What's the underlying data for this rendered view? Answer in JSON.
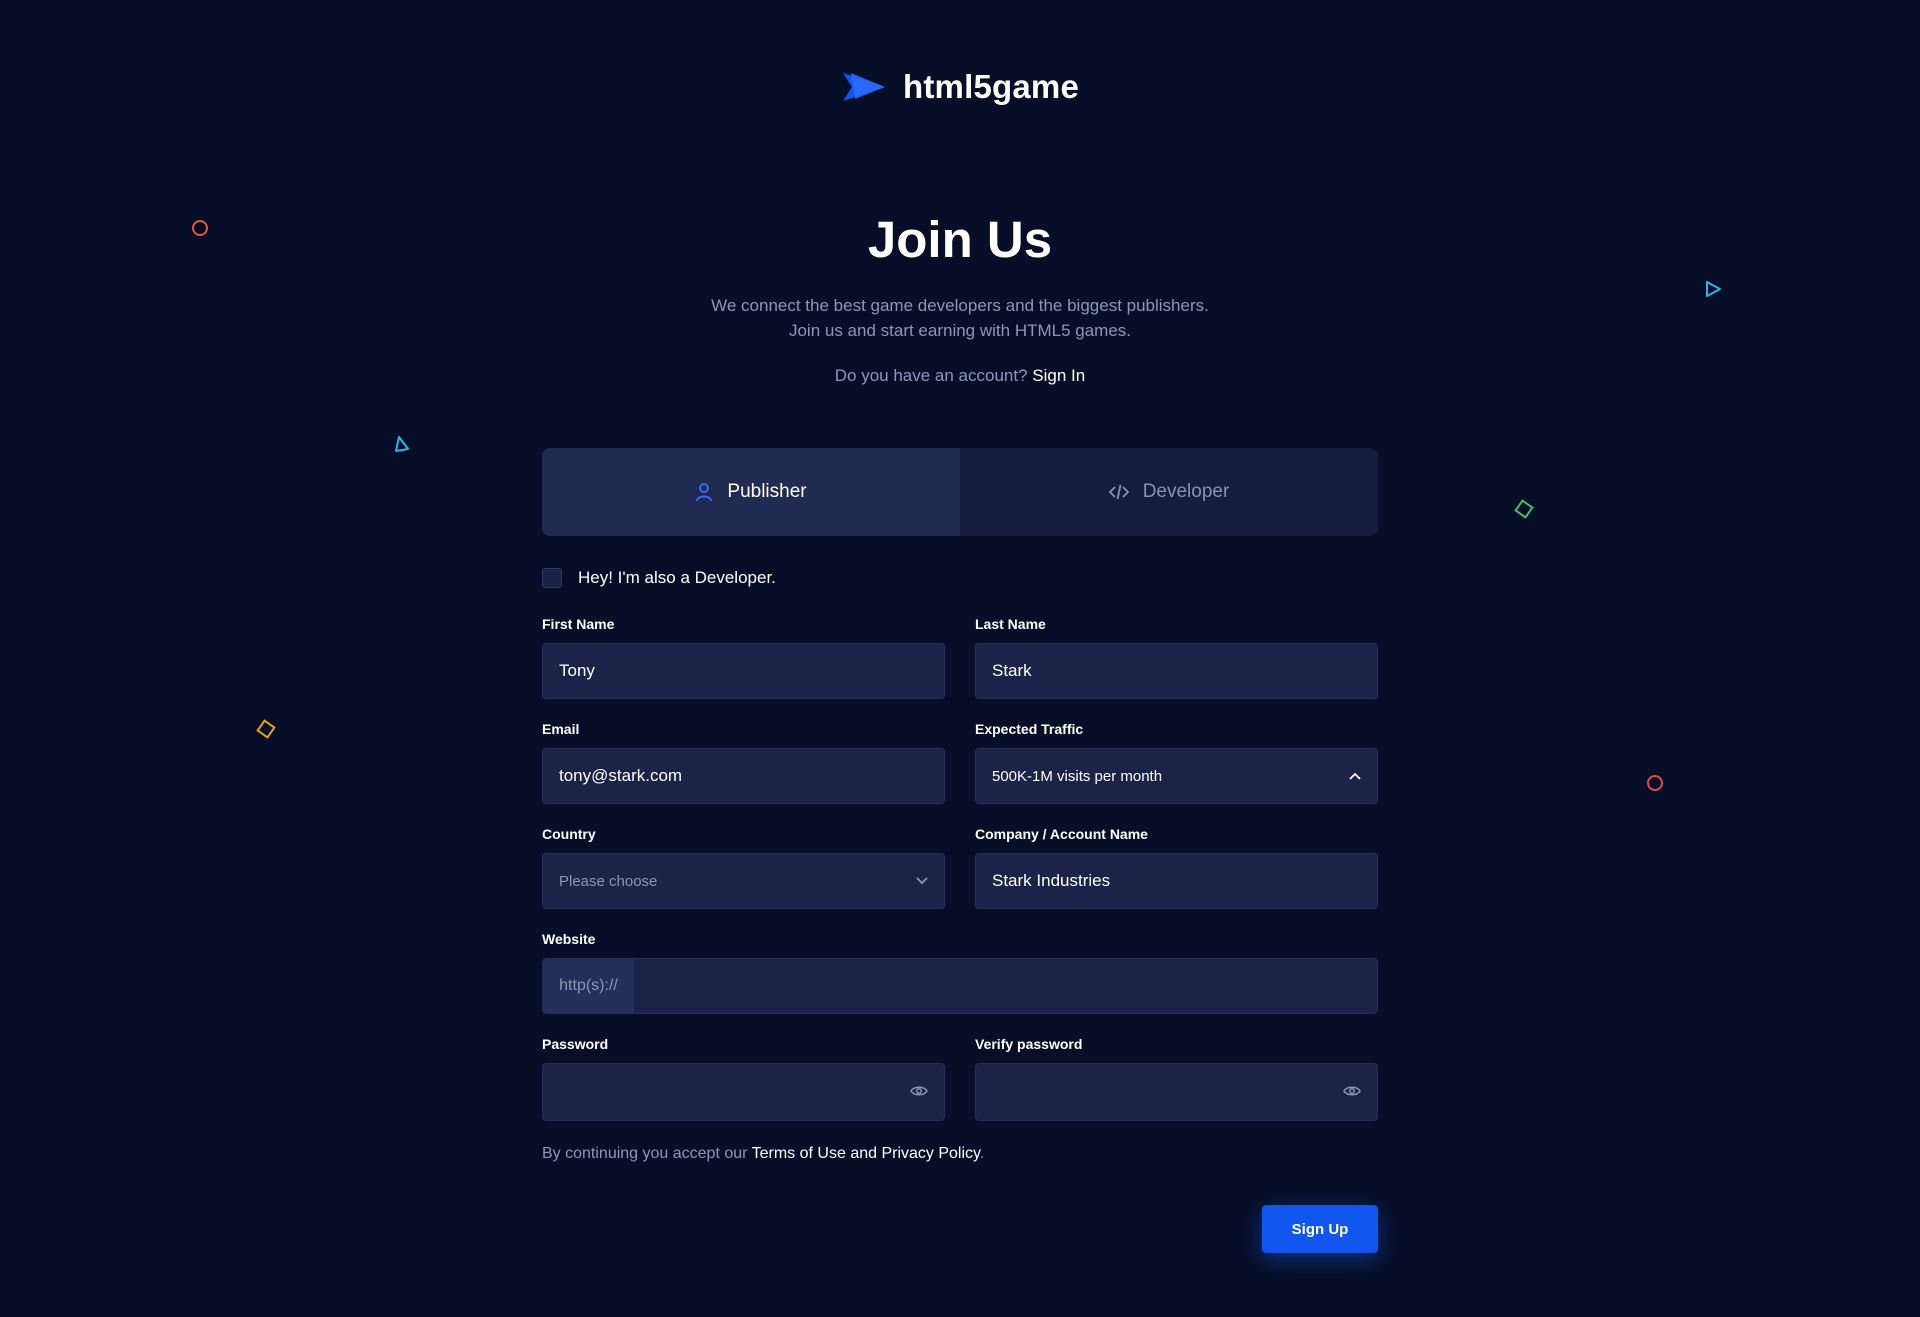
{
  "brand": {
    "name": "html5game"
  },
  "hero": {
    "title": "Join Us",
    "subtitle_line1": "We connect the best game developers and the biggest publishers.",
    "subtitle_line2": "Join us and start earning with HTML5 games.",
    "account_prompt": "Do you have an account?",
    "sign_in_label": "Sign In"
  },
  "tabs": [
    {
      "label": "Publisher",
      "icon": "user-icon",
      "active": true
    },
    {
      "label": "Developer",
      "icon": "code-icon",
      "active": false
    }
  ],
  "also_developer_label": "Hey! I'm also a Developer.",
  "fields": {
    "first_name": {
      "label": "First Name",
      "value": "Tony"
    },
    "last_name": {
      "label": "Last Name",
      "value": "Stark"
    },
    "email": {
      "label": "Email",
      "value": "tony@stark.com"
    },
    "expected_traffic": {
      "label": "Expected Traffic",
      "value": "500K-1M visits per month"
    },
    "country": {
      "label": "Country",
      "placeholder": "Please choose"
    },
    "company": {
      "label": "Company / Account Name",
      "value": "Stark Industries"
    },
    "website": {
      "label": "Website",
      "prefix": "http(s)://",
      "value": ""
    },
    "password": {
      "label": "Password",
      "value": ""
    },
    "verify_password": {
      "label": "Verify password",
      "value": ""
    }
  },
  "terms": {
    "prefix": "By continuing you accept our",
    "link": "Terms of Use and Privacy Policy",
    "suffix": "."
  },
  "submit_label": "Sign Up",
  "colors": {
    "background": "#070f28",
    "accent": "#1256f0",
    "input_bg": "#1b2448",
    "muted_text": "#8c97b8"
  }
}
